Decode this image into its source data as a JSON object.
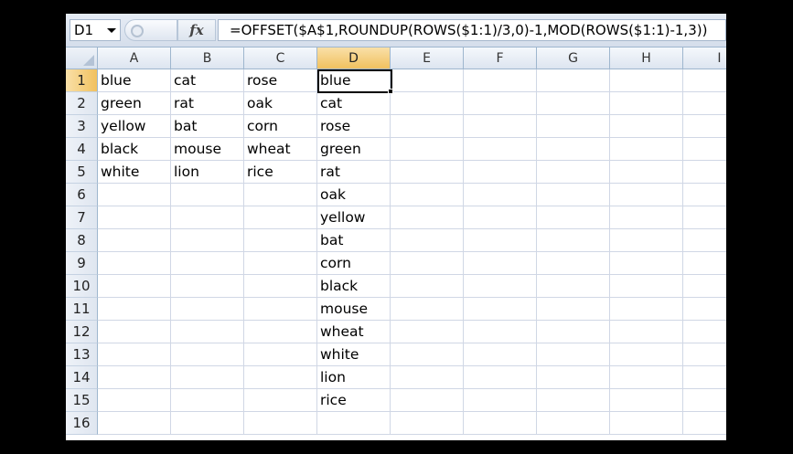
{
  "formula_bar": {
    "name_box": "D1",
    "fx_label": "fx",
    "formula": "=OFFSET($A$1,ROUNDUP(ROWS($1:1)/3,0)-1,MOD(ROWS($1:1)-1,3))"
  },
  "columns": [
    "A",
    "B",
    "C",
    "D",
    "E",
    "F",
    "G",
    "H",
    "I"
  ],
  "rows": [
    "1",
    "2",
    "3",
    "4",
    "5",
    "6",
    "7",
    "8",
    "9",
    "10",
    "11",
    "12",
    "13",
    "14",
    "15",
    "16"
  ],
  "selection": {
    "cell": "D1",
    "column": "D",
    "row": "1"
  },
  "cells": {
    "A": [
      "blue",
      "green",
      "yellow",
      "black",
      "white",
      "",
      "",
      "",
      "",
      "",
      "",
      "",
      "",
      "",
      "",
      ""
    ],
    "B": [
      "cat",
      "rat",
      "bat",
      "mouse",
      "lion",
      "",
      "",
      "",
      "",
      "",
      "",
      "",
      "",
      "",
      "",
      ""
    ],
    "C": [
      "rose",
      "oak",
      "corn",
      "wheat",
      "rice",
      "",
      "",
      "",
      "",
      "",
      "",
      "",
      "",
      "",
      "",
      ""
    ],
    "D": [
      "blue",
      "cat",
      "rose",
      "green",
      "rat",
      "oak",
      "yellow",
      "bat",
      "corn",
      "black",
      "mouse",
      "wheat",
      "white",
      "lion",
      "rice",
      ""
    ]
  }
}
